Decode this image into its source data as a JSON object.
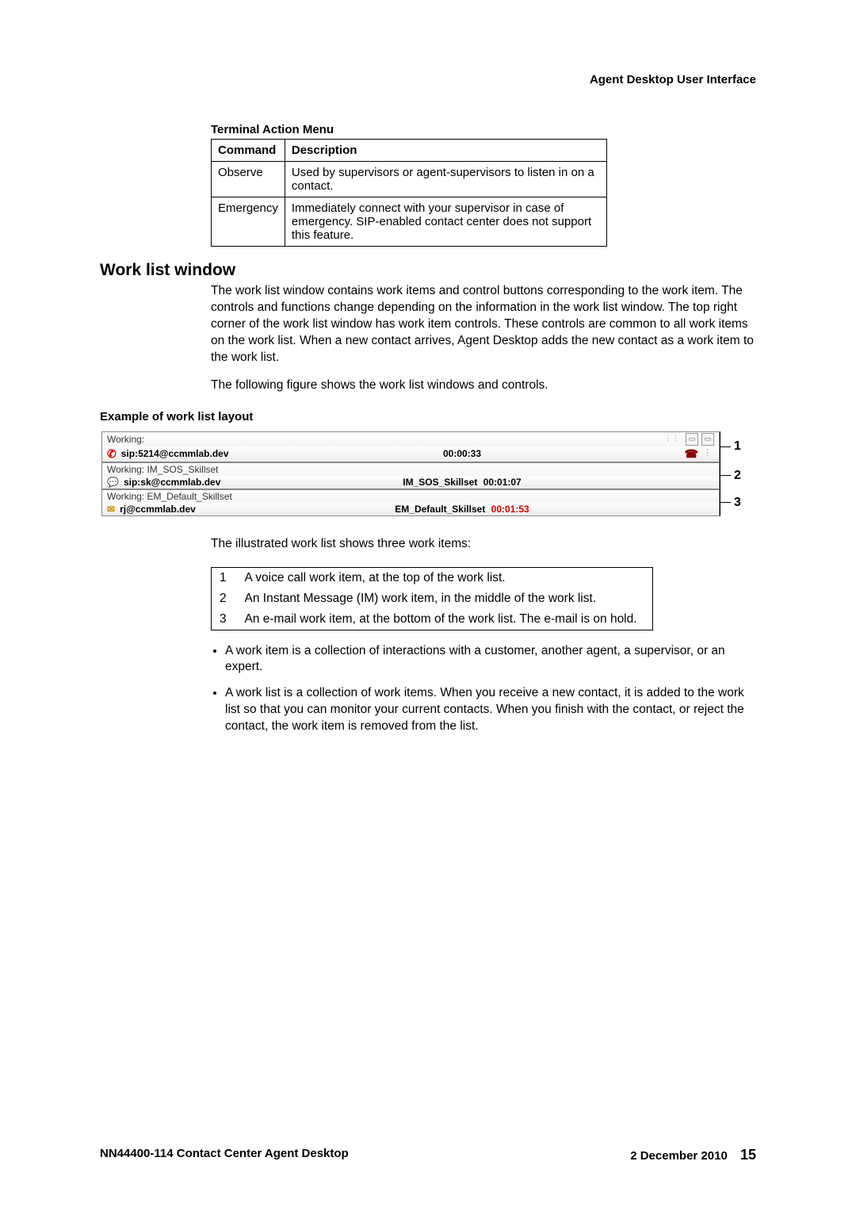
{
  "header": {
    "title": "Agent Desktop User Interface"
  },
  "terminal_action": {
    "title": "Terminal Action Menu",
    "columns": [
      "Command",
      "Description"
    ],
    "rows": [
      {
        "cmd": "Observe",
        "desc": "Used by supervisors or agent-supervisors to listen in on a contact."
      },
      {
        "cmd": "Emergency",
        "desc": "Immediately connect with your supervisor in case of emergency. SIP-enabled contact center does not support this feature."
      }
    ]
  },
  "section": {
    "heading": "Work list window",
    "para1": "The work list window contains work items and control buttons corresponding to the work item. The controls and functions change depending on the information in the work list window. The top right corner of the work list window has work item controls. These controls are common to all work items on the work list. When a new contact arrives, Agent Desktop adds the new contact as a work item to the work list.",
    "para2": "The following figure shows the work list windows and controls."
  },
  "example": {
    "title": "Example of work list layout",
    "items": [
      {
        "status": "Working:",
        "icon": "phone",
        "address": "sip:5214@ccmmlab.dev",
        "skillset": "",
        "timer": "00:00:33",
        "timer_red": false,
        "hold_icon": true,
        "top_buttons": true,
        "callout": "1"
      },
      {
        "status": "Working: IM_SOS_Skillset",
        "icon": "im",
        "address": "sip:sk@ccmmlab.dev",
        "skillset": "IM_SOS_Skillset",
        "timer": "00:01:07",
        "timer_red": false,
        "hold_icon": false,
        "top_buttons": false,
        "callout": "2"
      },
      {
        "status": "Working: EM_Default_Skillset",
        "icon": "mail",
        "address": "rj@ccmmlab.dev",
        "skillset": "EM_Default_Skillset",
        "timer": "00:01:53",
        "timer_red": true,
        "hold_icon": false,
        "top_buttons": false,
        "callout": "3"
      }
    ]
  },
  "post_figure": {
    "intro": "The illustrated work list shows three work items:",
    "legend": [
      {
        "n": "1",
        "text": "A voice call work item, at the top of the work list."
      },
      {
        "n": "2",
        "text": "An Instant Message (IM) work item, in the middle of the work list."
      },
      {
        "n": "3",
        "text": "An e-mail work item, at the bottom of the work list. The e-mail is on hold."
      }
    ],
    "bullets": [
      "A work item is a collection of interactions with a customer, another agent, a supervisor, or an expert.",
      "A work list is a collection of work items. When you receive a new contact, it is added to the work list so that you can monitor your current contacts. When you finish with the contact, or reject the contact, the work item is removed from the list."
    ]
  },
  "footer": {
    "left": "NN44400-114 Contact Center Agent Desktop",
    "date": "2 December 2010",
    "page": "15"
  }
}
